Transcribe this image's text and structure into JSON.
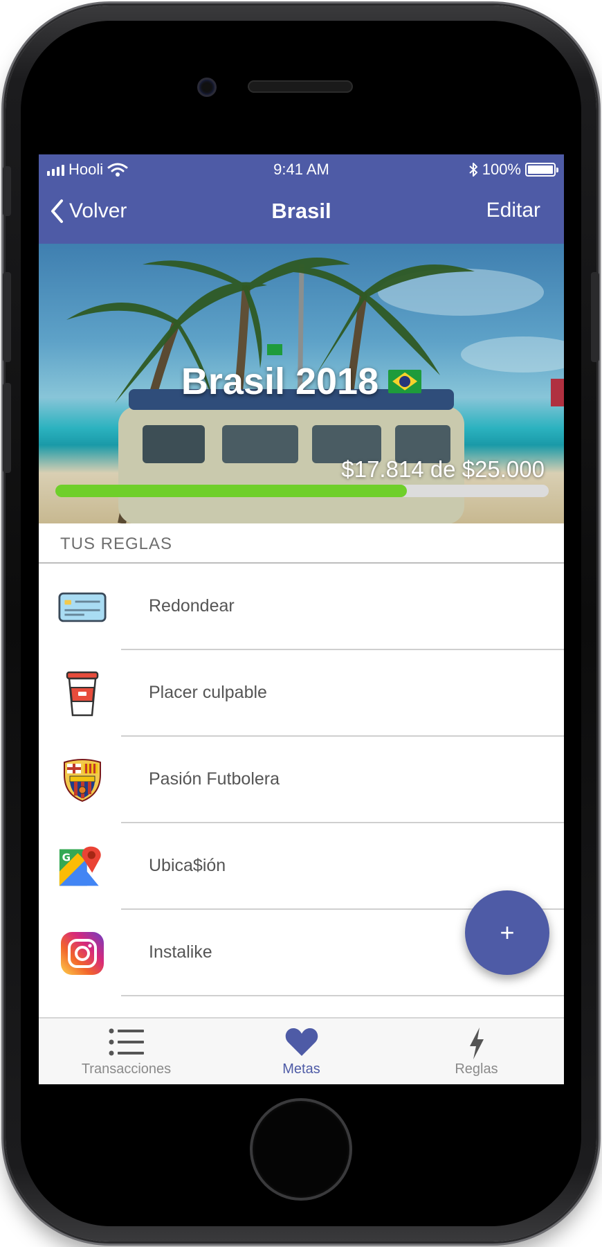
{
  "status_bar": {
    "carrier": "Hooli",
    "time": "9:41 AM",
    "battery": "100%"
  },
  "nav": {
    "back_label": "Volver",
    "title": "Brasil",
    "edit_label": "Editar"
  },
  "goal": {
    "title": "Brasil 2018",
    "amount_text": "$17.814 de $25.000",
    "current": 17814,
    "target": 25000,
    "progress_fraction": 0.7126
  },
  "rules_section": {
    "label": "TUS REGLAS",
    "items": [
      {
        "label": "Redondear",
        "icon": "credit-card-icon"
      },
      {
        "label": "Placer culpable",
        "icon": "coffee-cup-icon"
      },
      {
        "label": "Pasión Futbolera",
        "icon": "fcb-crest-icon"
      },
      {
        "label": "Ubica$ión",
        "icon": "google-maps-icon"
      },
      {
        "label": "Instalike",
        "icon": "instagram-icon"
      }
    ]
  },
  "fab": {
    "label": "+"
  },
  "tabbar": {
    "tabs": [
      {
        "label": "Transacciones",
        "icon": "list-icon"
      },
      {
        "label": "Metas",
        "icon": "heart-icon",
        "active": true
      },
      {
        "label": "Reglas",
        "icon": "lightning-icon"
      }
    ]
  },
  "colors": {
    "brand": "#4e5ba6",
    "progress": "#6fcf2a"
  }
}
